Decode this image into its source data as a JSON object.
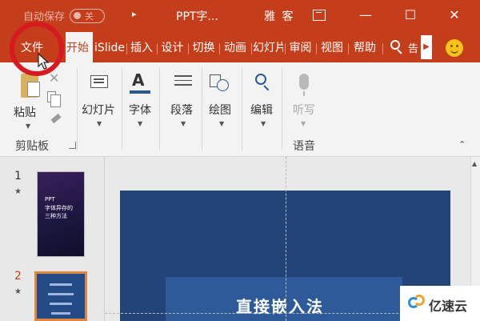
{
  "titlebar": {
    "autosave_label": "自动保存",
    "autosave_state": "关",
    "qat_more": "▸",
    "doc_title": "PPT字...",
    "user_name": "雅 客",
    "window_controls": [
      "—",
      "☐",
      "✕"
    ]
  },
  "tabs": [
    {
      "label": "文件",
      "active": false
    },
    {
      "label": "开始",
      "active": true
    },
    {
      "label": "iSlide",
      "active": false
    },
    {
      "label": "插入",
      "active": false
    },
    {
      "label": "设计",
      "active": false
    },
    {
      "label": "切换",
      "active": false
    },
    {
      "label": "动画",
      "active": false
    },
    {
      "label": "幻灯片",
      "active": false
    },
    {
      "label": "审阅",
      "active": false
    },
    {
      "label": "视图",
      "active": false
    },
    {
      "label": "帮助",
      "active": false
    }
  ],
  "tell_me": "告",
  "ribbon": {
    "paste": "粘贴",
    "clipboard_group": "剪贴板",
    "slides": "幻灯片",
    "font": "字体",
    "paragraph": "段落",
    "drawing": "绘图",
    "editing": "编辑",
    "dictate": "听写",
    "voice_group": "语音",
    "font_glyph": "A"
  },
  "slides_panel": {
    "slide1_number": "1",
    "slide2_number": "2",
    "star": "★",
    "thumb1_title_line1": "PPT",
    "thumb1_title_line2": "字体异存的",
    "thumb1_title_line3": "三种方法"
  },
  "slide": {
    "text": "直接嵌入法"
  },
  "watermark": {
    "text": "亿速云"
  },
  "colors": {
    "accent": "#c43e1c",
    "highlight_circle": "#d8191f",
    "slide_bg": "#224478"
  }
}
